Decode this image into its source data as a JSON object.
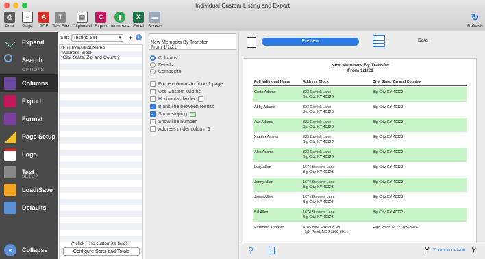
{
  "window": {
    "title": "Individual Custom Listing and Export"
  },
  "toolbar": [
    {
      "label": "Print",
      "icon": "printer-icon"
    },
    {
      "label": "Page",
      "icon": "page-icon"
    },
    {
      "label": "PDF",
      "icon": "pdf-icon"
    },
    {
      "label": "Text File",
      "icon": "text-file-icon"
    },
    {
      "label": "Clipboard",
      "icon": "clipboard-icon"
    },
    {
      "label": "Export",
      "icon": "csv-export-icon"
    },
    {
      "label": "Numbers",
      "icon": "numbers-icon"
    },
    {
      "label": "Excel",
      "icon": "excel-icon"
    },
    {
      "label": "Screen",
      "icon": "screen-icon"
    },
    {
      "label": "Refresh",
      "icon": "refresh-icon"
    }
  ],
  "sidebar": {
    "items": [
      "Expand",
      "Search",
      "Columns",
      "Export",
      "Format",
      "Page Setup",
      "Logo",
      "Text",
      "Load/Save",
      "Defaults",
      "Collapse"
    ],
    "sections": [
      "OPTIONS",
      "SETUP"
    ]
  },
  "columns_panel": {
    "set_label": "Set:",
    "set_value": "Testing Set",
    "plus": "+",
    "items": [
      "*Full Individual Name",
      "*Address Block",
      "*City, State, Zip and Country"
    ],
    "hint": "(* click ⓘ to customize field)",
    "button": "Configure Sorts and Totals"
  },
  "options": {
    "header_text": "New Members By Transfer\nFrom 1/1/21",
    "layout": [
      "Columns",
      "Details",
      "Composite"
    ],
    "layout_selected": "Columns",
    "checks": [
      {
        "label": "Force columns to fit on 1 page",
        "checked": false
      },
      {
        "label": "Use Custom Widths",
        "checked": false
      },
      {
        "label": "Horizontal divider",
        "checked": false
      },
      {
        "label": "Blank line between results",
        "checked": true
      },
      {
        "label": "Show striping",
        "checked": true
      },
      {
        "label": "Show line number",
        "checked": false
      },
      {
        "label": "Address under column 1",
        "checked": false
      }
    ],
    "stripe_color": "#c7f5c7"
  },
  "preview": {
    "tabs": [
      "Preview",
      "Data"
    ],
    "title_line1": "New Members By Transfer",
    "title_line2": "From 1/1/21",
    "headers": [
      "Full Individual Name",
      "Address Block",
      "City, State, Zip and Country"
    ],
    "rows": [
      {
        "name": "Greta Adams",
        "addr1": "823 Carrick Lane",
        "addr2": "Big City, KY  40123",
        "city": "Big City, KY  40123"
      },
      {
        "name": "Abby Adams",
        "addr1": "823 Carrick Lane",
        "addr2": "Big City, KY  40123",
        "city": "Big City, KY  40123"
      },
      {
        "name": "Ava Adams",
        "addr1": "823 Carrick Lane",
        "addr2": "Big City, KY  40123",
        "city": "Big City, KY  40123"
      },
      {
        "name": "Xander Adams",
        "addr1": "823 Carrick Lane",
        "addr2": "Big City, KY  40123",
        "city": "Big City, KY  40123"
      },
      {
        "name": "Alex Adams",
        "addr1": "823 Carrick Lane",
        "addr2": "Big City, KY  40123",
        "city": "Big City, KY  40123"
      },
      {
        "name": "Lucy Allen",
        "addr1": "1674 Stevens Lane",
        "addr2": "Big City, KY  40123",
        "city": "Big City, KY  40123"
      },
      {
        "name": "Jenny Allen",
        "addr1": "1674 Stevens Lane",
        "addr2": "Big City, KY  40123",
        "city": "Big City, KY  40123"
      },
      {
        "name": "Jesse Allen",
        "addr1": "1674 Stevens Lane",
        "addr2": "Big City, KY  40123",
        "city": "Big City, KY  40123"
      },
      {
        "name": "Bill Allen",
        "addr1": "1674 Stevens Lane",
        "addr2": "Big City, KY  40123",
        "city": "Big City, KY  40123"
      },
      {
        "name": "Elizabeth Andrews",
        "addr1": "4785 Blue Fox Run Rd",
        "addr2": "High Point, NC  27369-8914",
        "city": "High Point, NC  27369-8914"
      }
    ],
    "zoom_label": "Zoom to default"
  },
  "colors": {
    "accent": "#2c7be5",
    "sidebar": "#4a4a4a",
    "stripe": "#c7f5c7"
  }
}
